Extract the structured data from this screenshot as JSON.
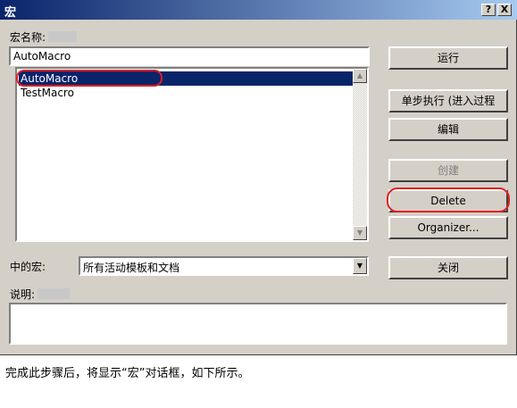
{
  "window": {
    "title": "宏",
    "help_button": "?",
    "close_button": "X"
  },
  "macro_name": {
    "label": "宏名称:",
    "value": "AutoMacro"
  },
  "macro_list": {
    "items": [
      {
        "label": "AutoMacro",
        "selected": true
      },
      {
        "label": "TestMacro",
        "selected": false
      }
    ]
  },
  "buttons": {
    "run": "运行",
    "step": "单步执行 (进入过程",
    "edit": "编辑",
    "create": "创建",
    "delete": "Delete",
    "organizer": "Organizer...",
    "close": "关闭"
  },
  "macros_in": {
    "label": "中的宏:",
    "selected": "所有活动模板和文档"
  },
  "description": {
    "label": "说明:",
    "value": ""
  },
  "caption": "完成此步骤后，将显示“宏”对话框，如下所示。",
  "colors": {
    "dialog_bg": "#d4d0c8",
    "title_start": "#0a246a",
    "title_end": "#a6caf0",
    "selection": "#0a246a",
    "highlight_outline": "#e02020"
  }
}
